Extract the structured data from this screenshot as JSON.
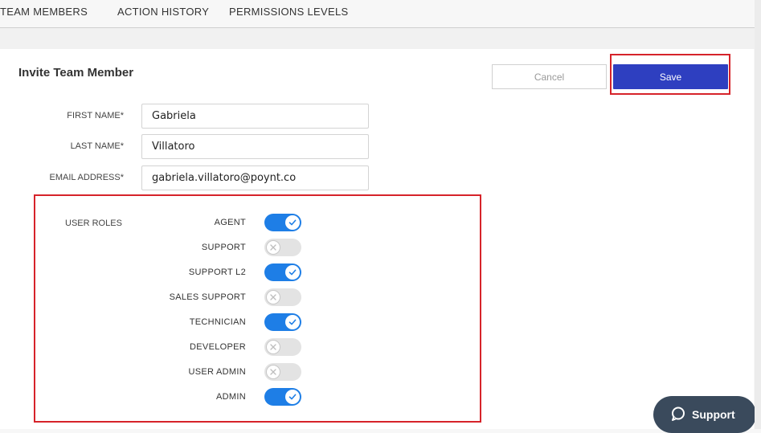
{
  "nav": {
    "tabs": [
      {
        "label": "TEAM MEMBERS"
      },
      {
        "label": "ACTION HISTORY"
      },
      {
        "label": "PERMISSIONS LEVELS"
      }
    ]
  },
  "form": {
    "title": "Invite Team Member",
    "cancel_label": "Cancel",
    "save_label": "Save",
    "fields": [
      {
        "label": "FIRST NAME*",
        "value": "Gabriela"
      },
      {
        "label": "LAST NAME*",
        "value": "Villatoro"
      },
      {
        "label": "EMAIL ADDRESS*",
        "value": "gabriela.villatoro@poynt.co"
      }
    ]
  },
  "roles": {
    "label": "USER ROLES",
    "items": [
      {
        "name": "AGENT",
        "enabled": true
      },
      {
        "name": "SUPPORT",
        "enabled": false
      },
      {
        "name": "SUPPORT L2",
        "enabled": true
      },
      {
        "name": "SALES SUPPORT",
        "enabled": false
      },
      {
        "name": "TECHNICIAN",
        "enabled": true
      },
      {
        "name": "DEVELOPER",
        "enabled": false
      },
      {
        "name": "USER ADMIN",
        "enabled": false
      },
      {
        "name": "ADMIN",
        "enabled": true
      }
    ]
  },
  "support": {
    "label": "Support",
    "icon": "chat-bubble-icon"
  },
  "colors": {
    "accent": "#2e3fc0",
    "toggle_on": "#1e7ee6",
    "highlight": "#d6232a"
  }
}
